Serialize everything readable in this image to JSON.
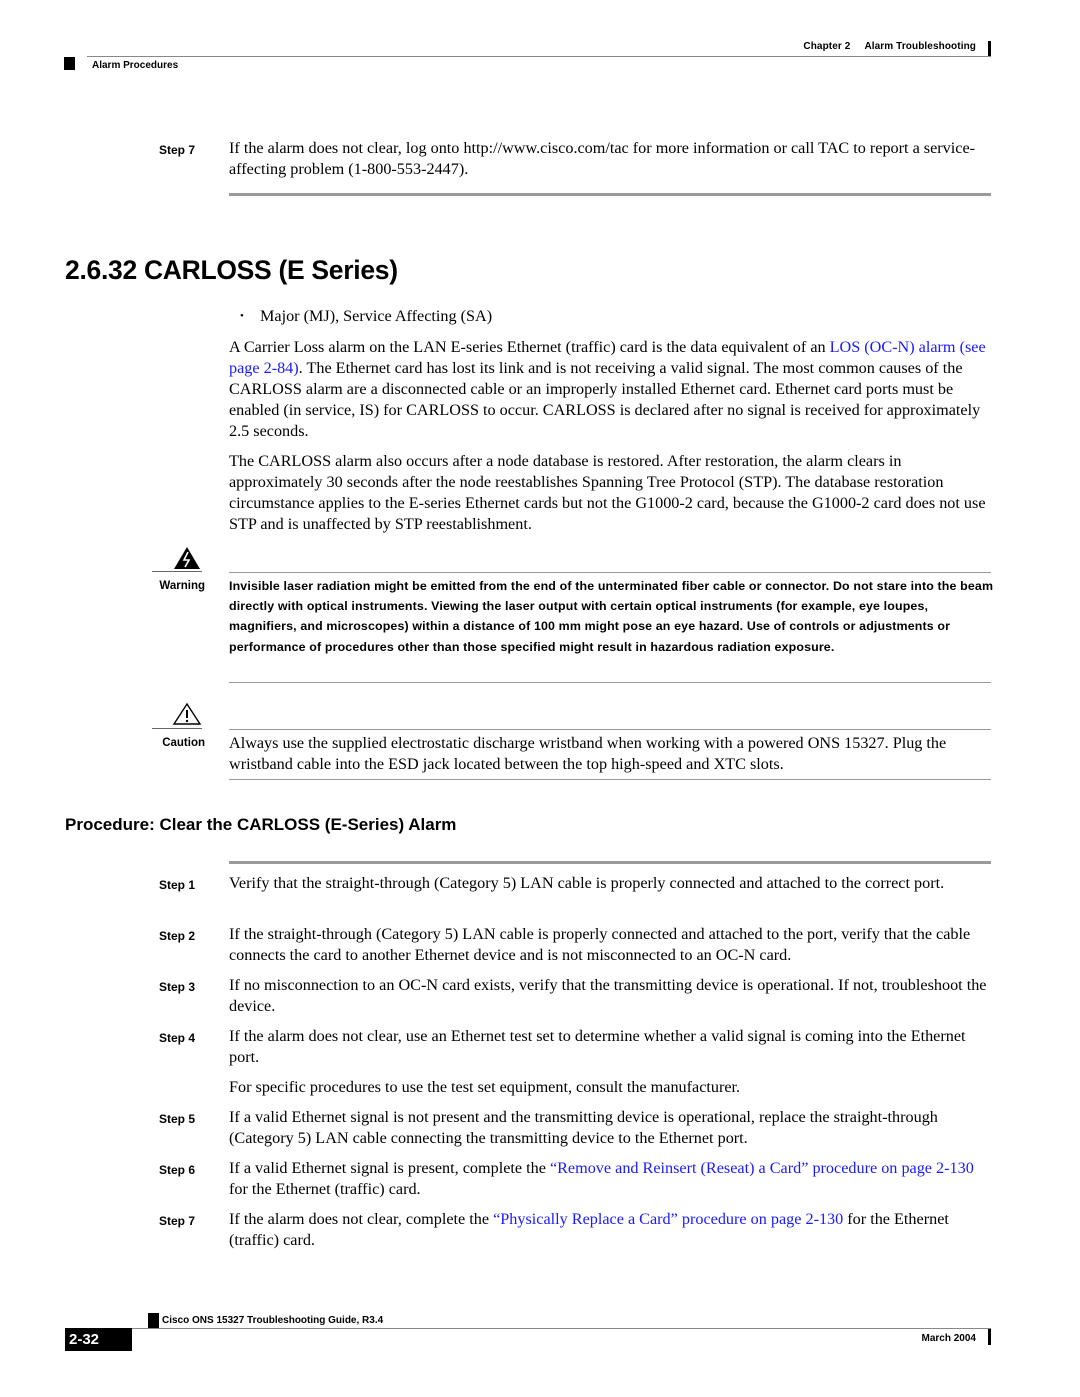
{
  "header": {
    "chapter": "Chapter 2",
    "chapter_title": "Alarm Troubleshooting",
    "section": "Alarm Procedures"
  },
  "prev_step": {
    "label": "Step 7",
    "text": "If the alarm does not clear, log onto http://www.cisco.com/tac for more information or call TAC to report a service-affecting problem (1-800-553-2447)."
  },
  "section": {
    "title": "2.6.32  CARLOSS (E Series)",
    "severity_bullet": "Major (MJ), Service Affecting (SA)",
    "para1": {
      "before_link": "A Carrier Loss alarm on the LAN E-series Ethernet (traffic) card is the data equivalent of an ",
      "link": "LOS (OC-N) alarm (see page 2-84)",
      "after_link": ". The Ethernet card has lost its link and is not receiving a valid signal. The most common causes of the CARLOSS alarm are a disconnected cable or an improperly installed Ethernet card. Ethernet card ports must be enabled (in service, IS) for CARLOSS to occur. CARLOSS is declared after no signal is received for approximately 2.5 seconds."
    },
    "para2": "The CARLOSS alarm also occurs after a node database is restored. After restoration, the alarm clears in approximately 30 seconds after the node reestablishes Spanning Tree Protocol (STP). The database restoration circumstance applies to the E-series Ethernet cards but not the G1000-2 card, because the G1000-2 card does not use STP and is unaffected by STP reestablishment."
  },
  "warning": {
    "icon": "warning-lightning-triangle-icon",
    "label": "Warning",
    "text": "Invisible laser radiation might be emitted from the end of the unterminated fiber cable or connector. Do not stare into the beam directly with optical instruments. Viewing the laser output with certain optical instruments (for example, eye loupes, magnifiers, and microscopes) within a distance of 100 mm might pose an eye hazard. Use of controls or adjustments or performance of procedures other than those specified might result in hazardous radiation exposure."
  },
  "caution": {
    "icon": "caution-exclamation-triangle-icon",
    "label": "Caution",
    "text": "Always use the supplied electrostatic discharge wristband when working with a powered ONS 15327. Plug the wristband cable into the ESD jack located between the top high-speed and XTC slots."
  },
  "procedure": {
    "title": "Procedure: Clear the CARLOSS (E-Series) Alarm",
    "steps": [
      {
        "label": "Step 1",
        "text": "Verify that the straight-through (Category 5) LAN cable is properly connected and attached to the correct port."
      },
      {
        "label": "Step 2",
        "text": "If the straight-through (Category 5) LAN cable is properly connected and attached to the port, verify that the cable connects the card to another Ethernet device and is not misconnected to an OC-N card."
      },
      {
        "label": "Step 3",
        "text": "If no misconnection to an OC-N card exists, verify that the transmitting device is operational. If not, troubleshoot the device."
      },
      {
        "label": "Step 4",
        "text": "If the alarm does not clear, use an Ethernet test set to determine whether a valid signal is coming into the Ethernet port.",
        "note": "For specific procedures to use the test set equipment, consult the manufacturer."
      },
      {
        "label": "Step 5",
        "text": "If a valid Ethernet signal is not present and the transmitting device is operational, replace the straight-through (Category 5) LAN cable connecting the transmitting device to the Ethernet port."
      },
      {
        "label": "Step 6",
        "before_link": "If a valid Ethernet signal is present, complete the ",
        "link": "“Remove and Reinsert (Reseat) a Card” procedure on page 2-130",
        "after_link": " for the Ethernet (traffic) card."
      },
      {
        "label": "Step 7",
        "before_link": "If the alarm does not clear, complete the ",
        "link": "“Physically Replace a Card” procedure on page 2-130",
        "after_link": " for the Ethernet (traffic) card."
      }
    ]
  },
  "footer": {
    "guide_title": "Cisco ONS 15327 Troubleshooting Guide, R3.4",
    "page_number": "2-32",
    "date": "March 2004"
  },
  "colors": {
    "link": "#1a1aff",
    "rule": "#9a9a9a"
  }
}
